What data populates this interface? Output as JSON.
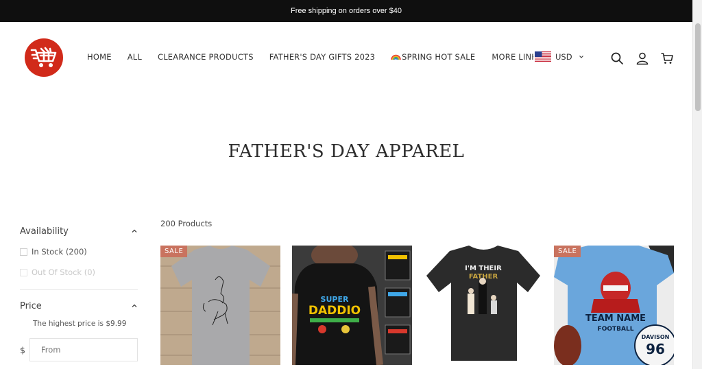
{
  "announcement": "Free shipping on orders over $40",
  "nav": {
    "home": "HOME",
    "all": "ALL",
    "clearance": "CLEARANCE PRODUCTS",
    "fathers_day": "FATHER'S DAY GIFTS 2023",
    "spring": "SPRING HOT SALE",
    "more": "MORE LINK"
  },
  "currency": {
    "code": "USD",
    "flag_icon": "us-flag-icon"
  },
  "header_icons": [
    "search-icon",
    "account-icon",
    "cart-icon"
  ],
  "page": {
    "title": "FATHER'S DAY APPAREL",
    "product_count": "200 Products"
  },
  "filters": {
    "availability": {
      "label": "Availability",
      "options": [
        "In Stock (200)",
        "Out Of Stock (0)"
      ]
    },
    "price": {
      "label": "Price",
      "note": "The highest price is $9.99",
      "currency_symbol": "$",
      "from_placeholder": "From"
    }
  },
  "products": [
    {
      "badge": "SALE"
    },
    {
      "badge": ""
    },
    {
      "badge": ""
    },
    {
      "badge": "SALE"
    }
  ],
  "product_art_text": {
    "p2_shirt": [
      "SUPER",
      "DADDIO"
    ],
    "p3_shirt": [
      "I'M THEIR",
      "FATHER"
    ],
    "p4_shirt": [
      "TEAM NAME",
      "FOOTBALL"
    ],
    "p4_jersey": [
      "DAVISON",
      "96"
    ]
  },
  "colors": {
    "announcement_bg": "#0f0f0f",
    "logo_red": "#d12a1a",
    "sale_badge": "#c9735f"
  }
}
